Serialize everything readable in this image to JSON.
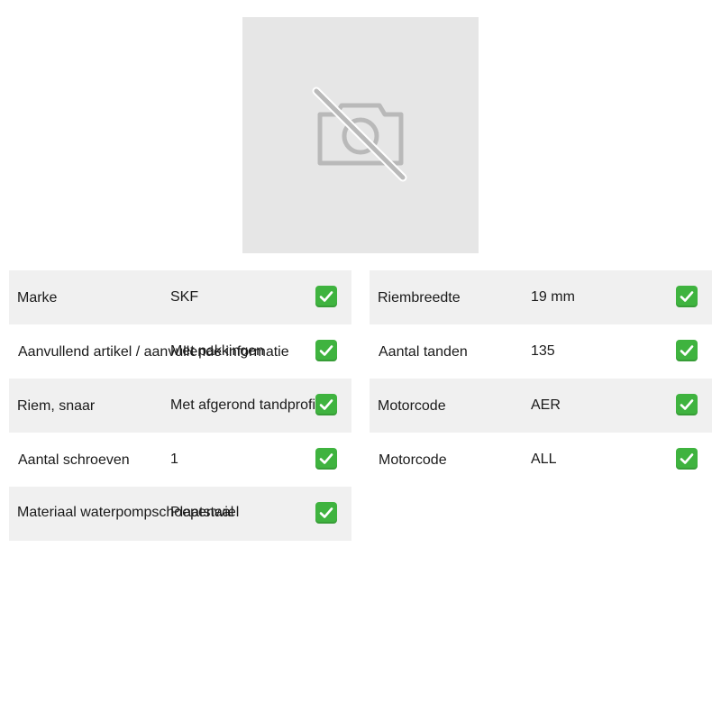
{
  "image": {
    "icon": "camera-off-icon"
  },
  "colors": {
    "row_shade": "#f0f0f0",
    "placeholder_bg": "#e6e6e6",
    "check_green": "#3fb33f"
  },
  "specs_left": [
    {
      "label": "Marke",
      "value": "SKF"
    },
    {
      "label": "Aanvullend artikel / aanvullende informatie",
      "value": "Met pakkingen"
    },
    {
      "label": "Riem, snaar",
      "value": "Met afgerond tandprofiel"
    },
    {
      "label": "Aantal schroeven",
      "value": "1"
    },
    {
      "label": "Materiaal waterpompschoepenwiel",
      "value": "Plaatstaal"
    }
  ],
  "specs_right": [
    {
      "label": "Riembreedte",
      "value": "19 mm"
    },
    {
      "label": "Aantal tanden",
      "value": "135"
    },
    {
      "label": "Motorcode",
      "value": "AER"
    },
    {
      "label": "Motorcode",
      "value": "ALL"
    }
  ]
}
